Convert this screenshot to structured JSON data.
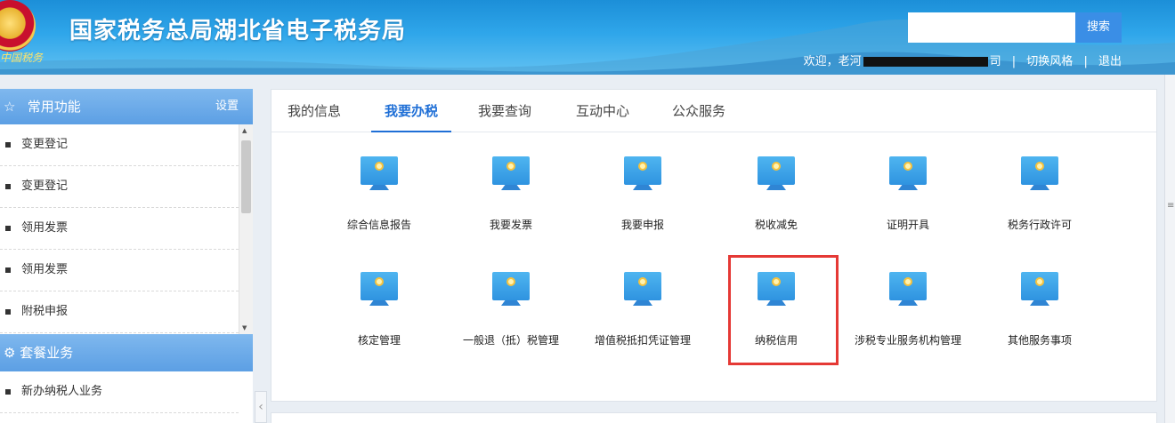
{
  "header": {
    "emblem_text": "中国税务",
    "title": "国家税务总局湖北省电子税务局",
    "search": {
      "placeholder": "",
      "button_label": "搜索"
    },
    "welcome_prefix": "欢迎，老河",
    "welcome_suffix": "司",
    "switch_style": "切换风格",
    "logout": "退出",
    "separator": "|"
  },
  "sidebar": {
    "section1": {
      "title": "常用功能",
      "setting": "设置",
      "icon": "star-icon"
    },
    "items": [
      {
        "label": "变更登记"
      },
      {
        "label": "变更登记"
      },
      {
        "label": "领用发票"
      },
      {
        "label": "领用发票"
      },
      {
        "label": "附税申报"
      }
    ],
    "section2": {
      "title": "套餐业务",
      "icon": "gear-icon"
    },
    "items2": [
      {
        "label": "新办纳税人业务"
      }
    ]
  },
  "tabs": [
    {
      "label": "我的信息",
      "active": false
    },
    {
      "label": "我要办税",
      "active": true
    },
    {
      "label": "我要查询",
      "active": false
    },
    {
      "label": "互动中心",
      "active": false
    },
    {
      "label": "公众服务",
      "active": false
    }
  ],
  "services": [
    {
      "label": "综合信息报告",
      "icon": "monitor-icon"
    },
    {
      "label": "我要发票",
      "icon": "monitor-icon"
    },
    {
      "label": "我要申报",
      "icon": "monitor-icon"
    },
    {
      "label": "税收减免",
      "icon": "monitor-icon"
    },
    {
      "label": "证明开具",
      "icon": "monitor-icon"
    },
    {
      "label": "税务行政许可",
      "icon": "monitor-icon"
    },
    {
      "label": "核定管理",
      "icon": "monitor-icon"
    },
    {
      "label": "一般退（抵）税管理",
      "icon": "monitor-icon"
    },
    {
      "label": "增值税抵扣凭证管理",
      "icon": "monitor-icon"
    },
    {
      "label": "纳税信用",
      "icon": "monitor-icon",
      "highlighted": true
    },
    {
      "label": "涉税专业服务机构管理",
      "icon": "monitor-icon"
    },
    {
      "label": "其他服务事项",
      "icon": "monitor-icon"
    }
  ],
  "colors": {
    "header": "#2fa6ea",
    "accent": "#1f6fd6",
    "highlight": "#e53935",
    "sidebar_head": "#6aa9e9"
  }
}
